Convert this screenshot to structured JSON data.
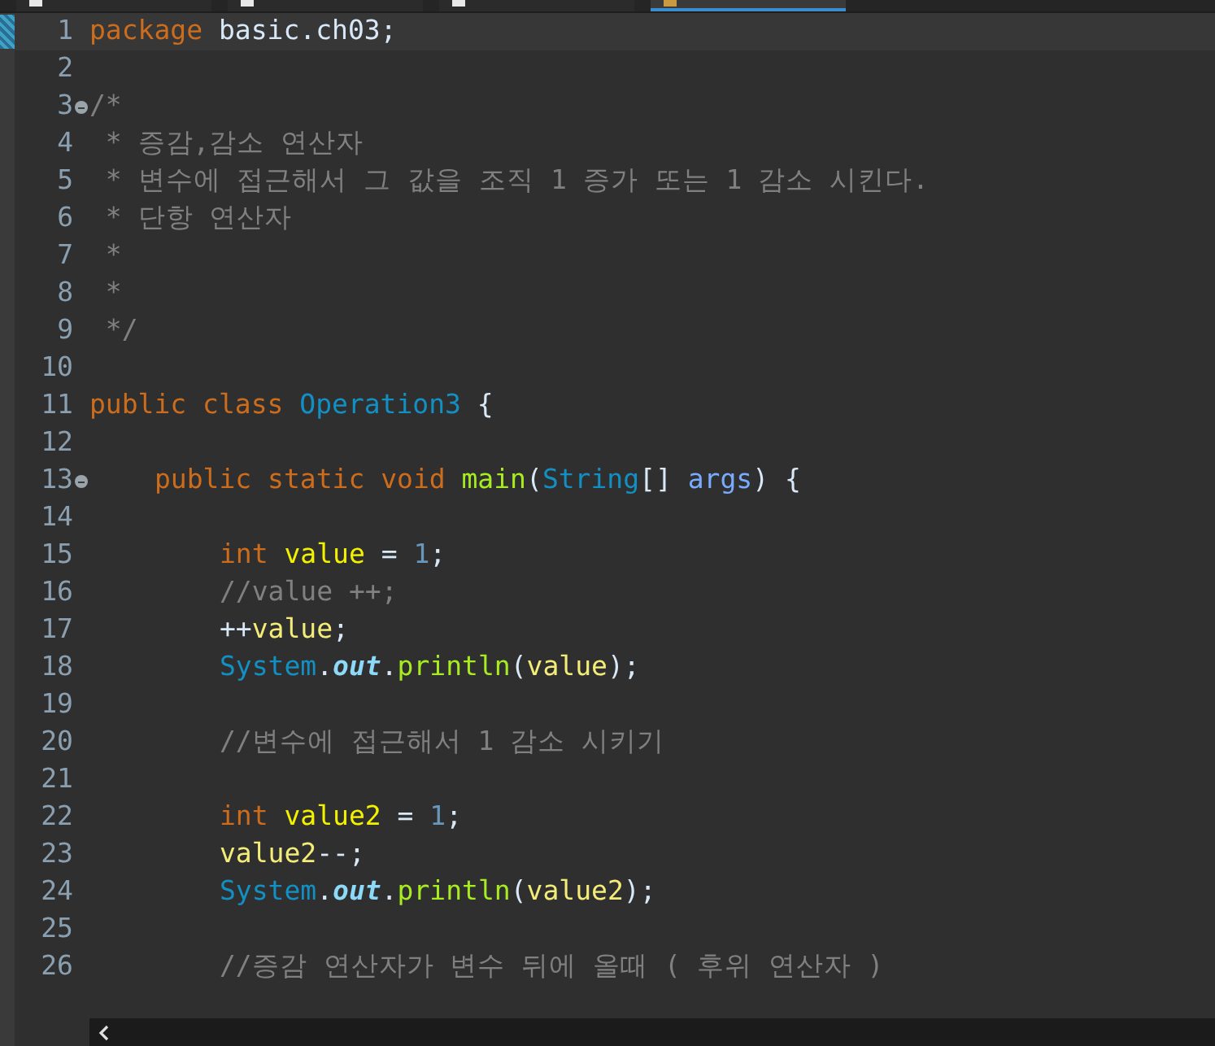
{
  "tabs": [
    {
      "selected": false
    },
    {
      "selected": false
    },
    {
      "selected": false
    },
    {
      "selected": true
    }
  ],
  "editor": {
    "lines": [
      {
        "number": "1",
        "current": true,
        "kind": "top",
        "tokens": [
          {
            "kind": "keyword",
            "text": "package"
          },
          {
            "kind": "plain",
            "text": " basic.ch03;"
          }
        ]
      },
      {
        "number": "2",
        "current": false,
        "kind": "top"
      },
      {
        "number": "3",
        "current": false,
        "kind": "top",
        "fold": true,
        "tokens": [
          {
            "kind": "comment",
            "text": "/*"
          }
        ]
      },
      {
        "number": "4",
        "current": false,
        "kind": "top",
        "tokens": [
          {
            "kind": "comment",
            "text": " * 증감,감소 연산자"
          }
        ]
      },
      {
        "number": "5",
        "current": false,
        "kind": "top",
        "tokens": [
          {
            "kind": "comment",
            "text": " * 변수에 접근해서 그 값을 조직 1 증가 또는 1 감소 시킨다."
          }
        ]
      },
      {
        "number": "6",
        "current": false,
        "kind": "top",
        "tokens": [
          {
            "kind": "comment",
            "text": " * 단항 연산자"
          }
        ]
      },
      {
        "number": "7",
        "current": false,
        "kind": "top",
        "tokens": [
          {
            "kind": "comment",
            "text": " *"
          }
        ]
      },
      {
        "number": "8",
        "current": false,
        "kind": "top",
        "tokens": [
          {
            "kind": "comment",
            "text": " *"
          }
        ]
      },
      {
        "number": "9",
        "current": false,
        "kind": "top",
        "tokens": [
          {
            "kind": "comment",
            "text": " */"
          }
        ]
      },
      {
        "number": "10",
        "current": false,
        "kind": "top"
      },
      {
        "number": "11",
        "current": false,
        "kind": "top",
        "tokens": [
          {
            "kind": "keyword",
            "text": "public class "
          },
          {
            "kind": "type",
            "text": "Operation3"
          },
          {
            "kind": "plain",
            "text": " {"
          }
        ]
      },
      {
        "number": "12",
        "current": false,
        "kind": "top"
      },
      {
        "number": "13",
        "current": false,
        "kind": "member",
        "fold": true,
        "tokens": [
          {
            "kind": "keyword",
            "text": "public static void "
          },
          {
            "kind": "method",
            "text": "main"
          },
          {
            "kind": "plain",
            "text": "("
          },
          {
            "kind": "type",
            "text": "String"
          },
          {
            "kind": "plain",
            "text": "[] "
          },
          {
            "kind": "param",
            "text": "args"
          },
          {
            "kind": "plain",
            "text": ") {"
          }
        ]
      },
      {
        "number": "14",
        "current": false,
        "kind": "member"
      },
      {
        "number": "15",
        "current": false,
        "kind": "body",
        "tokens": [
          {
            "kind": "keyword",
            "text": "int "
          },
          {
            "kind": "localvar",
            "text": "value"
          },
          {
            "kind": "plain",
            "text": " = "
          },
          {
            "kind": "number",
            "text": "1"
          },
          {
            "kind": "plain",
            "text": ";"
          }
        ]
      },
      {
        "number": "16",
        "current": false,
        "kind": "body",
        "tokens": [
          {
            "kind": "comment",
            "text": "//value ++;"
          }
        ]
      },
      {
        "number": "17",
        "current": false,
        "kind": "body",
        "tokens": [
          {
            "kind": "plain",
            "text": "++"
          },
          {
            "kind": "localref",
            "text": "value"
          },
          {
            "kind": "plain",
            "text": ";"
          }
        ]
      },
      {
        "number": "18",
        "current": false,
        "kind": "body",
        "tokens": [
          {
            "kind": "type",
            "text": "System"
          },
          {
            "kind": "plain",
            "text": "."
          },
          {
            "kind": "field",
            "text": "out"
          },
          {
            "kind": "plain",
            "text": "."
          },
          {
            "kind": "method",
            "text": "println"
          },
          {
            "kind": "plain",
            "text": "("
          },
          {
            "kind": "localref",
            "text": "value"
          },
          {
            "kind": "plain",
            "text": ");"
          }
        ]
      },
      {
        "number": "19",
        "current": false,
        "kind": "body"
      },
      {
        "number": "20",
        "current": false,
        "kind": "body",
        "tokens": [
          {
            "kind": "comment",
            "text": "//변수에 접근해서 1 감소 시키기"
          }
        ]
      },
      {
        "number": "21",
        "current": false,
        "kind": "body"
      },
      {
        "number": "22",
        "current": false,
        "kind": "body",
        "tokens": [
          {
            "kind": "keyword",
            "text": "int "
          },
          {
            "kind": "localvar",
            "text": "value2"
          },
          {
            "kind": "plain",
            "text": " = "
          },
          {
            "kind": "number",
            "text": "1"
          },
          {
            "kind": "plain",
            "text": ";"
          }
        ]
      },
      {
        "number": "23",
        "current": false,
        "kind": "body",
        "tokens": [
          {
            "kind": "localref",
            "text": "value2"
          },
          {
            "kind": "plain",
            "text": "--;"
          }
        ]
      },
      {
        "number": "24",
        "current": false,
        "kind": "body",
        "tokens": [
          {
            "kind": "type",
            "text": "System"
          },
          {
            "kind": "plain",
            "text": "."
          },
          {
            "kind": "field",
            "text": "out"
          },
          {
            "kind": "plain",
            "text": "."
          },
          {
            "kind": "method",
            "text": "println"
          },
          {
            "kind": "plain",
            "text": "("
          },
          {
            "kind": "localref",
            "text": "value2"
          },
          {
            "kind": "plain",
            "text": ");"
          }
        ]
      },
      {
        "number": "25",
        "current": false,
        "kind": "body"
      },
      {
        "number": "26",
        "current": false,
        "kind": "body",
        "tokens": [
          {
            "kind": "comment",
            "text": "//증감 연산자가 변수 뒤에 올때 ( 후위 연산자 )"
          }
        ]
      }
    ]
  }
}
